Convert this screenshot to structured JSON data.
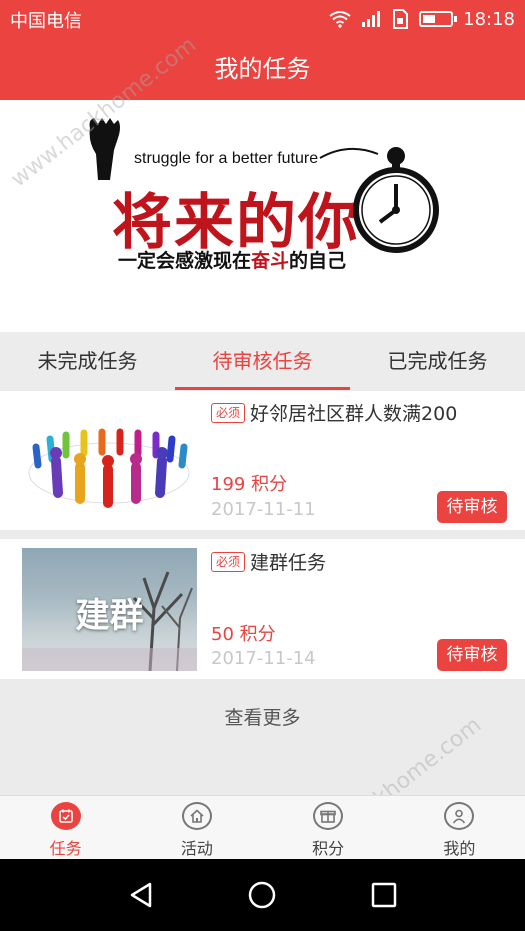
{
  "status_bar": {
    "carrier": "中国电信",
    "time": "18:18",
    "battery_level": 0.45
  },
  "header": {
    "title": "我的任务"
  },
  "banner": {
    "slogan": "struggle for a better future",
    "title": "将来的你",
    "subtitle_pre": "一定会感激现在",
    "subtitle_highlight": "奋斗",
    "subtitle_post": "的自己"
  },
  "tabs": [
    {
      "label": "未完成任务",
      "active": false
    },
    {
      "label": "待审核任务",
      "active": true
    },
    {
      "label": "已完成任务",
      "active": false
    }
  ],
  "tasks": [
    {
      "tag": "必须",
      "title": "好邻居社区群人数满200",
      "points": "199 积分",
      "date": "2017-11-11",
      "status": "待审核"
    },
    {
      "tag": "必须",
      "title": "建群任务",
      "thumb_text": "建群",
      "points": "50 积分",
      "date": "2017-11-14",
      "status": "待审核"
    }
  ],
  "load_more": "查看更多",
  "bottom_nav": [
    {
      "label": "任务",
      "icon": "task-icon",
      "active": true
    },
    {
      "label": "活动",
      "icon": "home-icon",
      "active": false
    },
    {
      "label": "积分",
      "icon": "points-icon",
      "active": false
    },
    {
      "label": "我的",
      "icon": "profile-icon",
      "active": false
    }
  ],
  "watermark": "www.hackhome.com",
  "colors": {
    "brand_red": "#ea4340",
    "banner_red": "#c0141d"
  }
}
